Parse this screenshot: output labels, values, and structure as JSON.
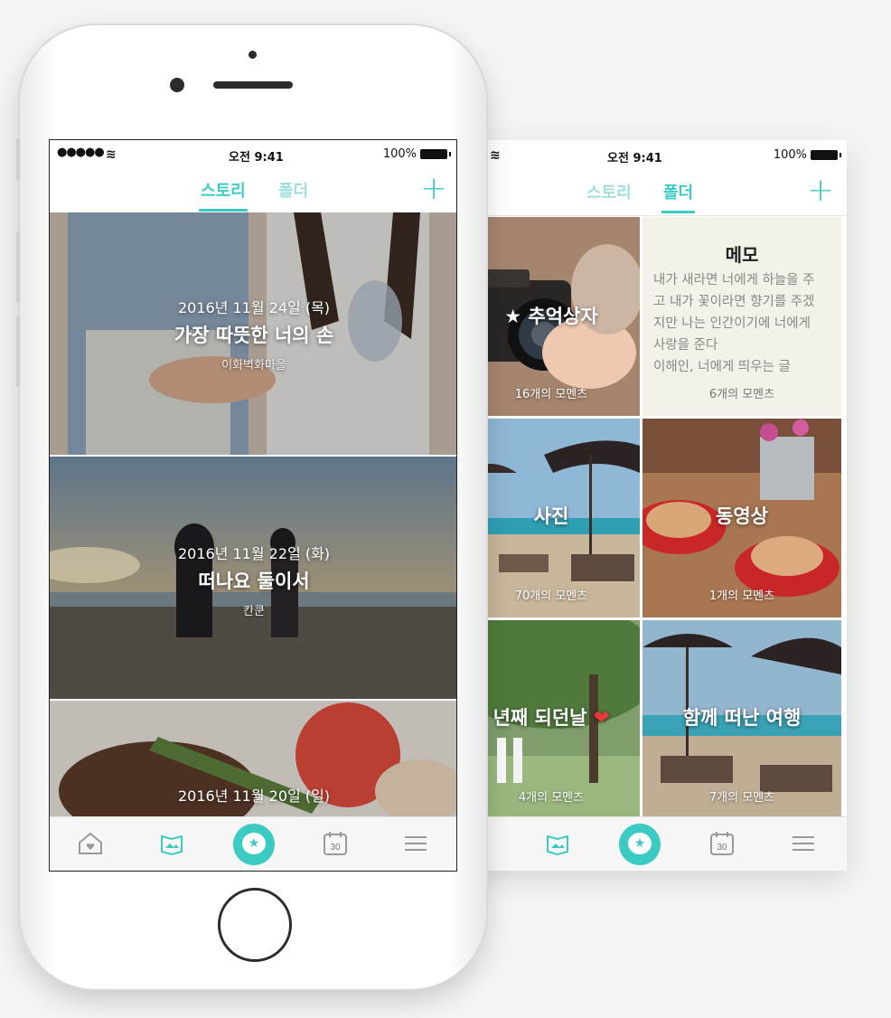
{
  "folder_screen": {
    "status": {
      "time": "오전 9:41",
      "battery": "100%"
    },
    "tabs": {
      "story": "스토리",
      "folder": "폴더"
    },
    "add_label": "+",
    "folders": [
      {
        "name": "추억상자",
        "count": "16개의 모멘츠"
      },
      {
        "name": "메모",
        "body_lines": [
          "내가 새라면 너에게 하늘을 주",
          "고 내가 꽃이라면 향기를 주겠",
          "지만 나는 인간이기에 너에게",
          "사랑을 준다",
          "이해인, 너에게 띄우는 글"
        ],
        "count": "6개의 모멘츠"
      },
      {
        "name": "사진",
        "count": "70개의 모멘츠"
      },
      {
        "name": "동영상",
        "count": "1개의 모멘츠"
      },
      {
        "name": "년째 되던날",
        "count": "4개의 모멘츠"
      },
      {
        "name": "함께 떠난 여행",
        "count": "7개의 모멘츠"
      }
    ],
    "tabbar": [
      "home-icon",
      "album-icon",
      "moments-star-icon",
      "calendar-icon",
      "menu-icon"
    ]
  },
  "story_screen": {
    "status": {
      "signal": "●●●●●",
      "time": "오전 9:41",
      "battery": "100%"
    },
    "tabs": {
      "story": "스토리",
      "folder": "폴더"
    },
    "add_label": "+",
    "stories": [
      {
        "date": "2016년 11월 24일 (목)",
        "title": "가장 따뜻한 너의 손",
        "place": "이화벽화마을"
      },
      {
        "date": "2016년 11월 22일 (화)",
        "title": "떠나요 둘이서",
        "place": "칸쿤"
      },
      {
        "date": "2016년 11월 20일 (일)",
        "title": "",
        "place": ""
      }
    ],
    "calendar_day": "30",
    "tabbar": [
      "home-icon",
      "album-icon",
      "moments-star-icon",
      "calendar-icon",
      "menu-icon"
    ]
  }
}
